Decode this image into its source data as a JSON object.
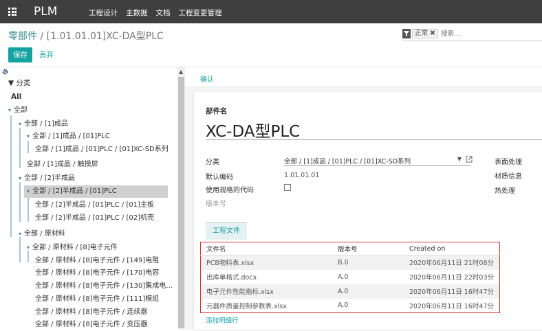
{
  "topbar": {
    "apps_icon": "apps-grid-icon",
    "brand": "PLM",
    "menu": [
      "工程设计",
      "主数据",
      "文档",
      "工程变更管理"
    ]
  },
  "breadcrumb": {
    "parent": "零部件",
    "separator": " / ",
    "current": "[1.01.01.01]XC-DA型PLC"
  },
  "actions": {
    "save": "保存",
    "discard": "丢弃"
  },
  "search": {
    "filter_icon": "filter-icon",
    "facet_label": "正常",
    "facet_remove": "✖",
    "placeholder": "搜索..."
  },
  "sidebar": {
    "settings_icon": "gear-icon",
    "category_title": "分类",
    "all_label": "All",
    "tree": [
      {
        "label": "全部"
      },
      {
        "label": "全部 / [1]成品"
      },
      {
        "label": "全部 / [1]成品 / [01]PLC"
      },
      {
        "label": "全部 / [1]成品 / [01]PLC / [01]XC-SD系列"
      },
      {
        "label": "全部 / [1]成品 / 触摸屏"
      },
      {
        "label": "全部 / [2]半成品"
      },
      {
        "label": "全部 / [2]半成品 / [01]PLC"
      },
      {
        "label": "全部 / [2]半成品 / [01]PLC / [01]主板"
      },
      {
        "label": "全部 / [2]半成品 / [01]PLC / [02]机壳"
      },
      {
        "label": "全部 / 原材料"
      },
      {
        "label": "全部 / 原材料 / [8]电子元件"
      },
      {
        "label": "全部 / 原材料 / [8]电子元件 / [149]电阻"
      },
      {
        "label": "全部 / 原材料 / [8]电子元件 / [170]电容"
      },
      {
        "label": "全部 / 原材料 / [8]电子元件 / [130]集成电…"
      },
      {
        "label": "全部 / 原材料 / [8]电子元件 / [111]模组"
      },
      {
        "label": "全部 / 原材料 / [8]电子元件 / 连续器"
      },
      {
        "label": "全部 / 原材料 / [8]电子元件 / 变压器"
      }
    ],
    "selected_index": 6
  },
  "statusbar": {
    "confirm": "确认"
  },
  "form": {
    "name_label": "部件名",
    "name_value": "XC-DA型PLC",
    "category_label": "分类",
    "category_value": "全部 / [1]成品 / [01]PLC / [01]XC-SD系列",
    "default_code_label": "默认编码",
    "default_code_value": "1.01.01.01",
    "use_spec_code_label": "使用规格的代码",
    "version_label": "版本号",
    "right_labels": [
      "表面处理",
      "材质信息",
      "热处理"
    ],
    "tab_label": "工程文件",
    "table": {
      "headers": [
        "文件名",
        "版本号",
        "Created on"
      ],
      "rows": [
        [
          "PCB物料表.xlsx",
          "B.0",
          "2020年06月11日 21时08分"
        ],
        [
          "出库单格式.docx",
          "A.0",
          "2020年06月11日 22时03分"
        ],
        [
          "电子元件性能指标.xlsx",
          "A.0",
          "2020年06月11日 16时47分"
        ],
        [
          "元器件质量控制参数表.xlsx",
          "A.0",
          "2020年06月11日 16时47分"
        ]
      ]
    },
    "add_line": "添加明细行"
  }
}
